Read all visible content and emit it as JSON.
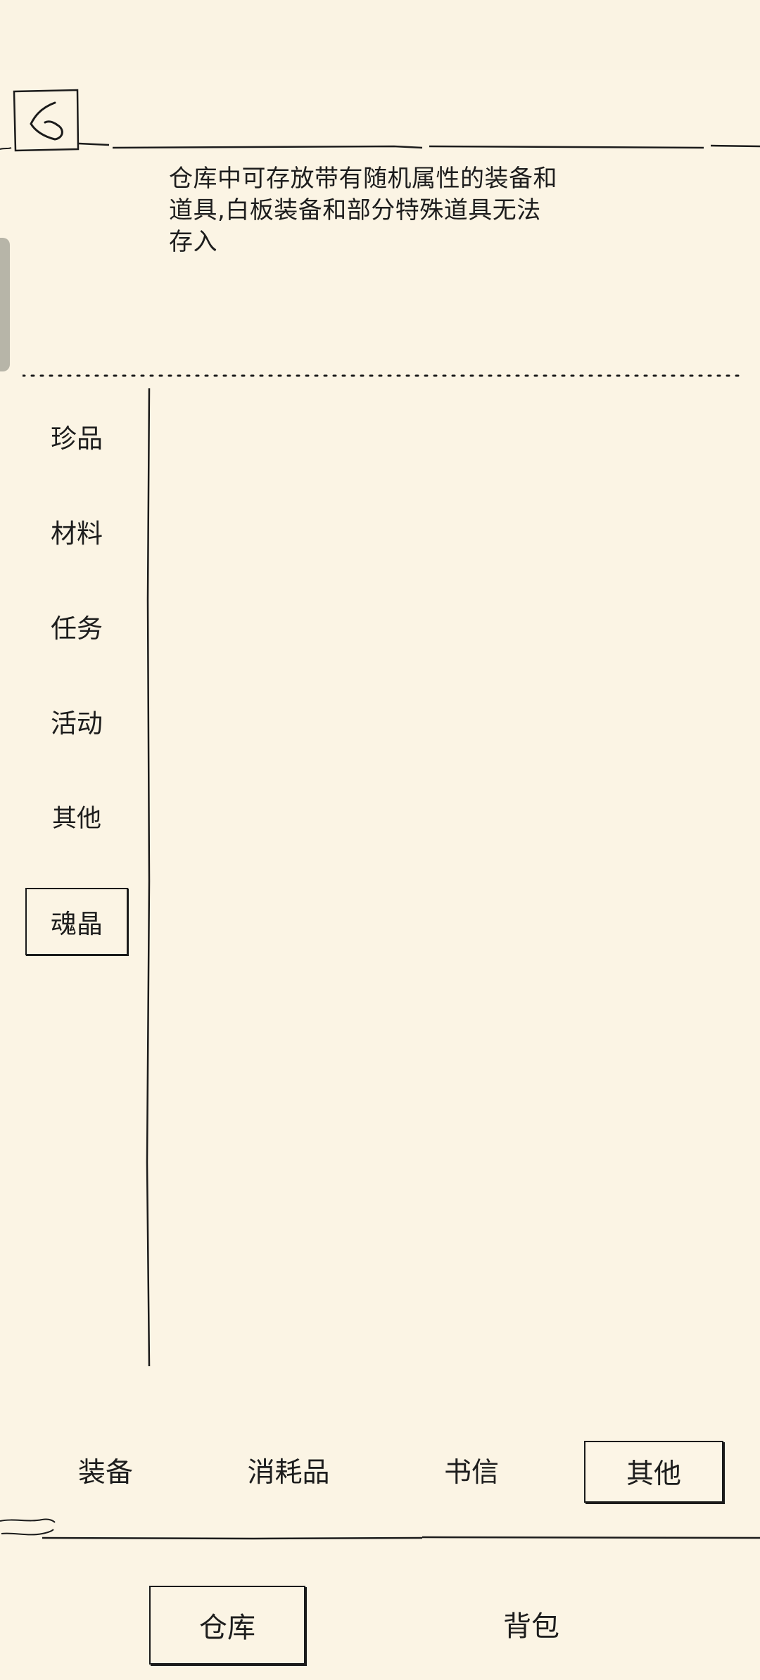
{
  "info": {
    "lines": [
      "仓库中可存放带有随机属性的装备和",
      "道具,白板装备和部分特殊道具无法",
      "存入"
    ]
  },
  "side_menu": {
    "items": [
      {
        "label": "珍品",
        "selected": false
      },
      {
        "label": "材料",
        "selected": false
      },
      {
        "label": "任务",
        "selected": false
      },
      {
        "label": "活动",
        "selected": false
      },
      {
        "label": "其他",
        "selected": false
      },
      {
        "label": "魂晶",
        "selected": true
      }
    ]
  },
  "category_tabs": {
    "items": [
      {
        "label": "装备",
        "selected": false
      },
      {
        "label": "消耗品",
        "selected": false
      },
      {
        "label": "书信",
        "selected": false
      },
      {
        "label": "其他",
        "selected": true
      }
    ]
  },
  "bottom_nav": {
    "items": [
      {
        "label": "仓库",
        "selected": true
      },
      {
        "label": "背包",
        "selected": false
      }
    ]
  },
  "icons": {
    "back": "back-chevron-icon"
  },
  "colors": {
    "background": "#fbf4e4",
    "ink": "#1b1b1b"
  }
}
